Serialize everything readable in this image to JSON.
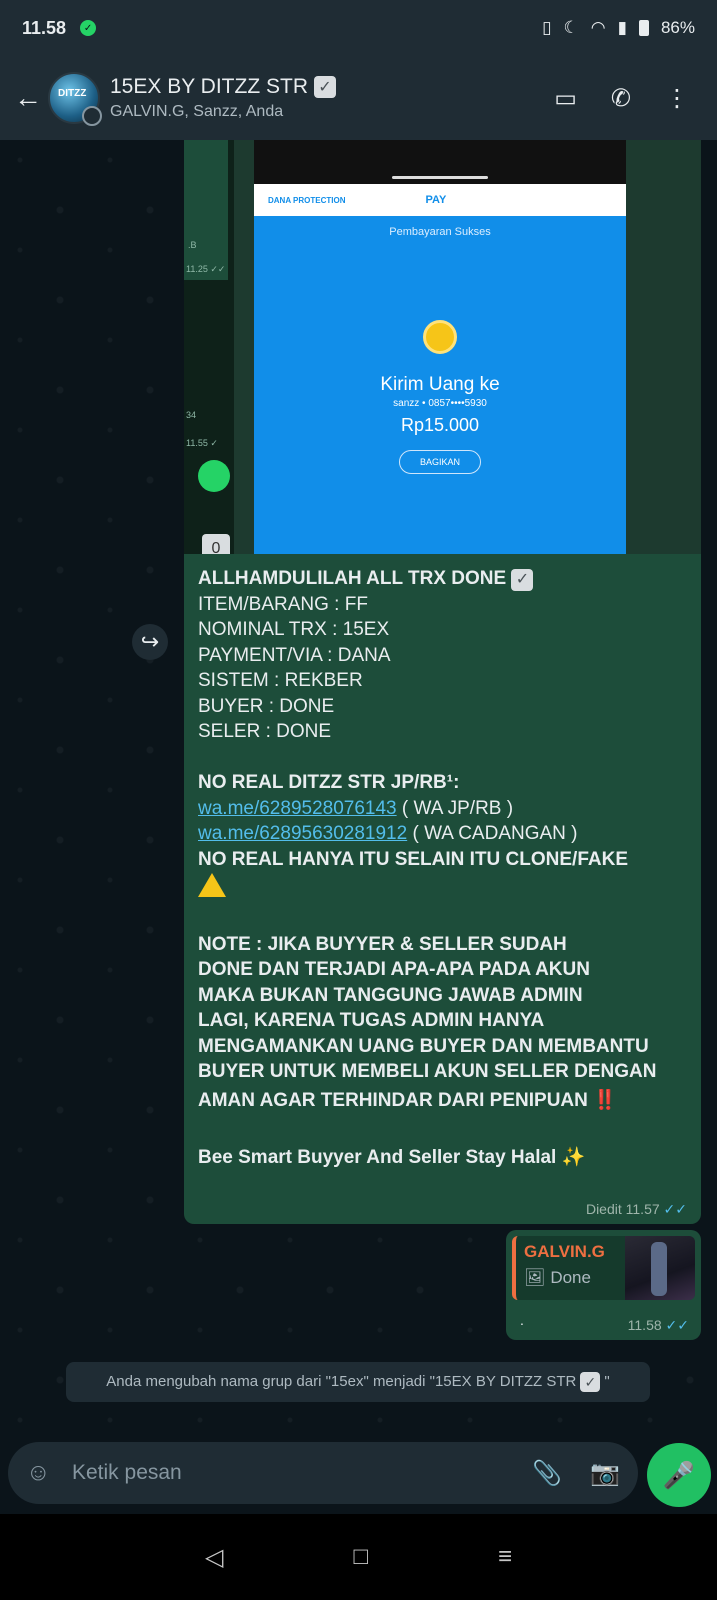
{
  "status_bar": {
    "time": "11.58",
    "battery": "86%"
  },
  "header": {
    "back_icon": "←",
    "title": "15EX BY DITZZ STR",
    "title_emoji": "✓",
    "subtitle": "GALVIN.G, Sanzz, Anda",
    "video_icon": "▭",
    "call_icon": "✆",
    "menu_icon": "⋮"
  },
  "image_message": {
    "dana": {
      "brand": "DANA PROTECTION",
      "pay": "PAY",
      "status": "Pembayaran Sukses",
      "headline": "Kirim Uang ke",
      "recipient": "sanzz • 0857••••5930",
      "amount": "Rp15.000",
      "share": "BAGIKAN"
    },
    "left_strip": {
      "text_b": ".B",
      "time1": "11.25 ✓✓",
      "text_34": "34",
      "time2": "11.55 ✓",
      "zero": "0"
    }
  },
  "text_message": {
    "forward_icon": "↪",
    "lines": {
      "l1": "ALLHAMDULILAH ALL TRX DONE",
      "l2": "ITEM/BARANG : FF",
      "l3": "NOMINAL TRX : 15EX",
      "l4": "PAYMENT/VIA : DANA",
      "l5": "SISTEM : REKBER",
      "l6": "BUYER : DONE",
      "l7": "SELER : DONE",
      "l8": "NO REAL DITZZ STR JP/RB¹:",
      "link1": "wa.me/6289528076143",
      "link1_suffix": " ( WA JP/RB )",
      "link2": "wa.me/62895630281912",
      "link2_suffix": " ( WA CADANGAN )",
      "l9": "NO REAL HANYA ITU SELAIN ITU CLONE/FAKE",
      "n1": "NOTE : JIKA BUYYER & SELLER SUDAH",
      "n2": "DONE DAN TERJADI APA-APA PADA AKUN",
      "n3": "MAKA BUKAN TANGGUNG JAWAB ADMIN",
      "n4": "LAGI, KARENA TUGAS ADMIN HANYA",
      "n5": "MENGAMANKAN UANG BUYER DAN MEMBANTU",
      "n6": "BUYER UNTUK MEMBELI AKUN SELLER DENGAN",
      "n7": "AMAN AGAR TERHINDAR DARI PENIPUAN",
      "n7_emoji": "‼️",
      "closing": "Bee Smart Buyyer And Seller Stay Halal",
      "closing_emoji": "✨"
    },
    "edited_label": "Diedit",
    "time": "11.57",
    "ticks": "✓✓"
  },
  "reply_message": {
    "quoted_name": "GALVIN.G",
    "quoted_icon": "🖼",
    "quoted_text": "Done",
    "body": ".",
    "time": "11.58",
    "ticks": "✓✓"
  },
  "system_message": {
    "text": "Anda mengubah nama grup dari \"15ex\" menjadi \"15EX BY DITZZ STR",
    "emoji": "✓",
    "suffix": "\""
  },
  "input": {
    "placeholder": "Ketik pesan",
    "emoji_icon": "☺",
    "attach_icon": "📎",
    "camera_icon": "📷",
    "mic_icon": "🎤"
  },
  "nav": {
    "back": "◁",
    "home": "□",
    "recents": "≡"
  }
}
